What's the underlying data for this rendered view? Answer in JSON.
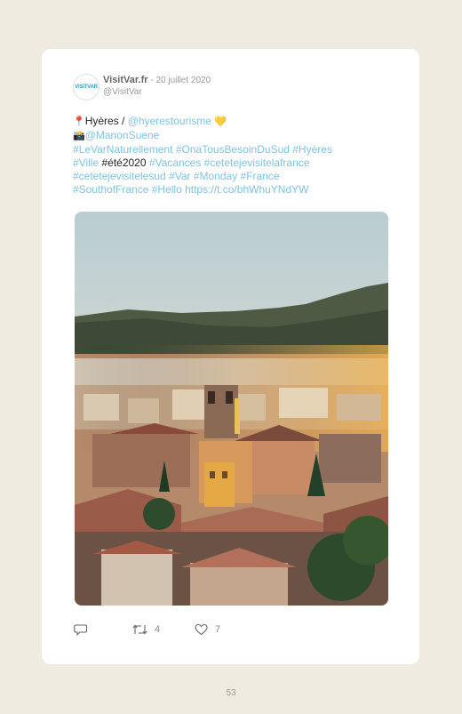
{
  "tweet": {
    "author": "VisitVar.fr",
    "separator": " - ",
    "date": "20 juillet 2020",
    "handle": "@VisitVar",
    "avatar_text": "VISITVAR",
    "lines": [
      [
        {
          "t": "📍",
          "k": "emoji"
        },
        {
          "t": "Hyères / ",
          "k": "plain"
        },
        {
          "t": "@hyerestourisme",
          "k": "link"
        },
        {
          "t": " 💛",
          "k": "emoji"
        }
      ],
      [
        {
          "t": "📸",
          "k": "emoji"
        },
        {
          "t": "@ManonSuene",
          "k": "link"
        }
      ],
      [
        {
          "t": "#LeVarNaturellement #OnaTousBesoinDuSud #Hyères",
          "k": "link"
        }
      ],
      [
        {
          "t": "#Ville ",
          "k": "link"
        },
        {
          "t": "#été2020 ",
          "k": "plain"
        },
        {
          "t": "#Vacances #cetetejevisitelafrance",
          "k": "link"
        }
      ],
      [
        {
          "t": "#cetetejevisitelesud #Var #Monday #France",
          "k": "link"
        }
      ],
      [
        {
          "t": "#SouthofFrance #Hello https://t.co/bhWhuYNdYW",
          "k": "link"
        }
      ]
    ],
    "retweets": "4",
    "likes": "7"
  },
  "icons": {
    "reply": "reply-icon",
    "retweet": "retweet-icon",
    "like": "heart-icon"
  },
  "photo": {
    "subject": "hillside-town-photo"
  },
  "page_number": "53"
}
